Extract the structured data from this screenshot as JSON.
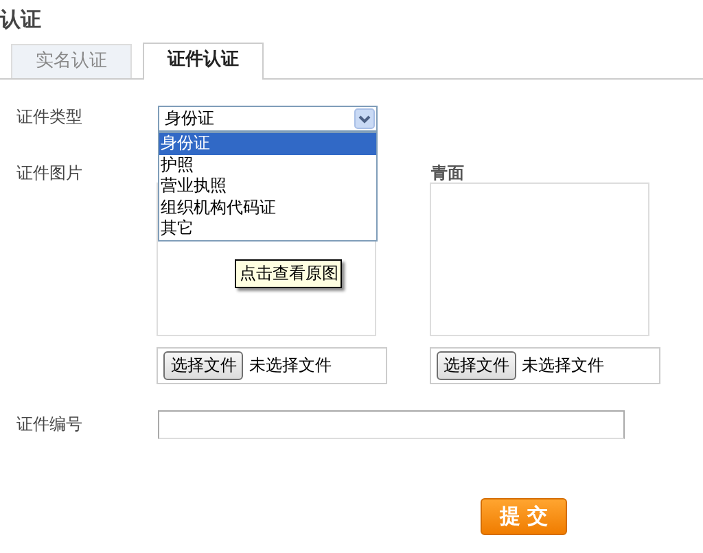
{
  "page": {
    "title": "认证"
  },
  "tabs": [
    {
      "label": "实名认证",
      "selected": false
    },
    {
      "label": "证件认证",
      "selected": true
    }
  ],
  "form": {
    "type_label": "证件类型",
    "type_select": {
      "value": "身份证",
      "expanded": true,
      "options": [
        {
          "label": "身份证",
          "selected": true
        },
        {
          "label": "护照",
          "selected": false
        },
        {
          "label": "营业执照",
          "selected": false
        },
        {
          "label": "组织机构代码证",
          "selected": false
        },
        {
          "label": "其它",
          "selected": false
        }
      ]
    },
    "image_label": "证件图片",
    "front": {
      "tooltip": "点击查看原图",
      "file_button": "选择文件",
      "file_status": "未选择文件"
    },
    "back": {
      "title": "青面",
      "file_button": "选择文件",
      "file_status": "未选择文件"
    },
    "number_label": "证件编号",
    "submit": "提 交"
  }
}
